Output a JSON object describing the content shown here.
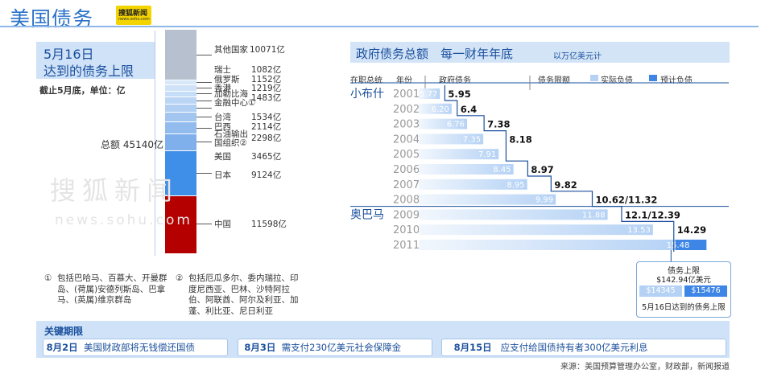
{
  "header": {
    "title": "美国债务",
    "logo_line1": "搜狐新闻",
    "logo_line2": "news.sohu.com"
  },
  "left": {
    "deadline_date": "5月16日",
    "deadline_text": "达到的债务上限",
    "as_of": "截止5月底，单位：亿",
    "total_label": "总额 45140亿",
    "holders": [
      {
        "name": "其他国家",
        "value": "10071亿",
        "amount": 10071,
        "color": "#b6c0cf"
      },
      {
        "name": "瑞士",
        "value": "1082亿",
        "amount": 1082,
        "color": "#d8e8f9"
      },
      {
        "name": "俄罗斯",
        "value": "1152亿",
        "amount": 1152,
        "color": "#cfe2f8"
      },
      {
        "name": "香港",
        "value": "1219亿",
        "amount": 1219,
        "color": "#c6ddf7"
      },
      {
        "name": "加勒比海 金融中心①",
        "value": "1483亿",
        "amount": 1483,
        "color": "#bbd6f5"
      },
      {
        "name": "台湾",
        "value": "1534亿",
        "amount": 1534,
        "color": "#b0cff3"
      },
      {
        "name": "巴西",
        "value": "2114亿",
        "amount": 2114,
        "color": "#a3c6f0"
      },
      {
        "name": "石油输出 国组织②",
        "value": "2298亿",
        "amount": 2298,
        "color": "#93bcee"
      },
      {
        "name": "美国",
        "value": "3465亿",
        "amount": 3465,
        "color": "#7fb0ec"
      },
      {
        "name": "日本",
        "value": "9124亿",
        "amount": 9124,
        "color": "#3f8ee8"
      },
      {
        "name": "中国",
        "value": "11598亿",
        "amount": 11598,
        "color": "#b50000"
      }
    ],
    "note1_num": "①",
    "note1_text": "包括巴哈马、百慕大、开曼群岛、(荷属)安德列斯岛、巴拿马、(英属)维京群岛",
    "note2_num": "②",
    "note2_text": "包括厄瓜多尔、委内瑞拉、印度尼西亚、巴林、沙特阿拉伯、阿联酋、阿尔及利亚、加蓬、利比亚、尼日利亚"
  },
  "right": {
    "title": "政府债务总额　每一财年年底",
    "unit": "以万亿美元计",
    "col_president": "在职总统",
    "col_year": "年份",
    "col_gov_debt": "政府债务",
    "col_limit": "债务限额",
    "legend_actual": "实际负债",
    "legend_forecast": "预计负债",
    "color_actual": "#b5d2f5",
    "color_forecast": "#3e86e6",
    "president_1": "小布什",
    "president_2": "奥巴马",
    "cap_box": {
      "title": "债务上限",
      "amount": "$142.94亿美元",
      "left_val": "$14345",
      "right_val": "$15476",
      "caption": "5月16日达到的债务上限"
    }
  },
  "chart_data": {
    "type": "bar",
    "title": "政府债务总额　每一财年年底",
    "unit": "以万亿美元计",
    "categories": [
      "2001",
      "2002",
      "2003",
      "2004",
      "2005",
      "2006",
      "2007",
      "2008",
      "2009",
      "2010",
      "2011"
    ],
    "series": [
      {
        "name": "实际负债",
        "values": [
          5.77,
          6.2,
          6.76,
          7.35,
          7.91,
          8.45,
          8.95,
          9.99,
          11.88,
          13.53,
          14.345
        ]
      },
      {
        "name": "预计负债",
        "values": [
          null,
          null,
          null,
          null,
          null,
          null,
          null,
          null,
          null,
          null,
          15.48
        ]
      },
      {
        "name": "债务限额",
        "values": [
          5.95,
          6.4,
          7.38,
          8.18,
          8.18,
          8.97,
          9.82,
          11.32,
          12.39,
          14.29,
          14.29
        ]
      }
    ],
    "bar_labels": [
      "5.77",
      "6.20",
      "6.76",
      "7.35",
      "7.91",
      "8.45",
      "8.95",
      "9.99",
      "11.88",
      "13.53",
      "15.48"
    ],
    "limit_labels": [
      "5.95",
      "6.4",
      "7.38",
      "8.18",
      "",
      "8.97",
      "9.82",
      "10.62/11.32",
      "12.1/12.39",
      "14.29",
      ""
    ],
    "xlim": [
      5,
      15.5
    ]
  },
  "bottom": {
    "title": "关键期限",
    "items": [
      {
        "date": "8月2日",
        "text": "美国财政部将无钱偿还国债"
      },
      {
        "date": "8月3日",
        "text": "需支付230亿美元社会保障金"
      },
      {
        "date": "8月15日",
        "text": "应支付给国债持有者300亿美元利息"
      }
    ],
    "source": "来源：美国预算管理办公室，财政部，新闻报道"
  }
}
